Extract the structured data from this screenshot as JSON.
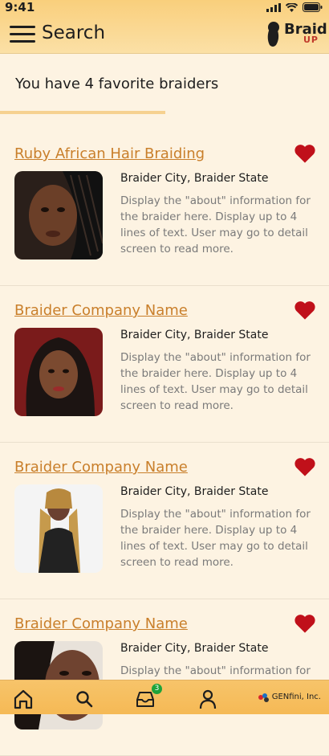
{
  "status": {
    "time": "9:41"
  },
  "header": {
    "title": "Search",
    "logo_line1": "Braid",
    "logo_line2": "UP"
  },
  "favorites": {
    "count_text": "You have 4 favorite braiders"
  },
  "braiders": [
    {
      "name": "Ruby African Hair Braiding",
      "location": "Braider City, Braider State",
      "about": "Display the \"about\" information for the braider here. Display up to 4 lines of text. User may go to detail screen to read more."
    },
    {
      "name": "Braider Company Name",
      "location": "Braider City, Braider State",
      "about": "Display the \"about\" information for the braider here. Display up to 4 lines of text. User may go to detail screen to read more."
    },
    {
      "name": "Braider Company Name",
      "location": "Braider City, Braider State",
      "about": "Display the \"about\" information for the braider here. Display up to 4 lines of text. User may go to detail screen to read more."
    },
    {
      "name": "Braider Company Name",
      "location": "Braider City, Braider State",
      "about": "Display the \"about\" information for the"
    }
  ],
  "bottom_nav": {
    "items": [
      {
        "icon": "home-icon"
      },
      {
        "icon": "search-icon"
      },
      {
        "icon": "inbox-icon",
        "badge": "3"
      },
      {
        "icon": "profile-icon"
      }
    ],
    "brand": "GENfini, Inc."
  },
  "colors": {
    "header": "#f9cf7c",
    "link": "#c97f2b",
    "heart": "#c0101a",
    "background": "#fdf3e2"
  }
}
